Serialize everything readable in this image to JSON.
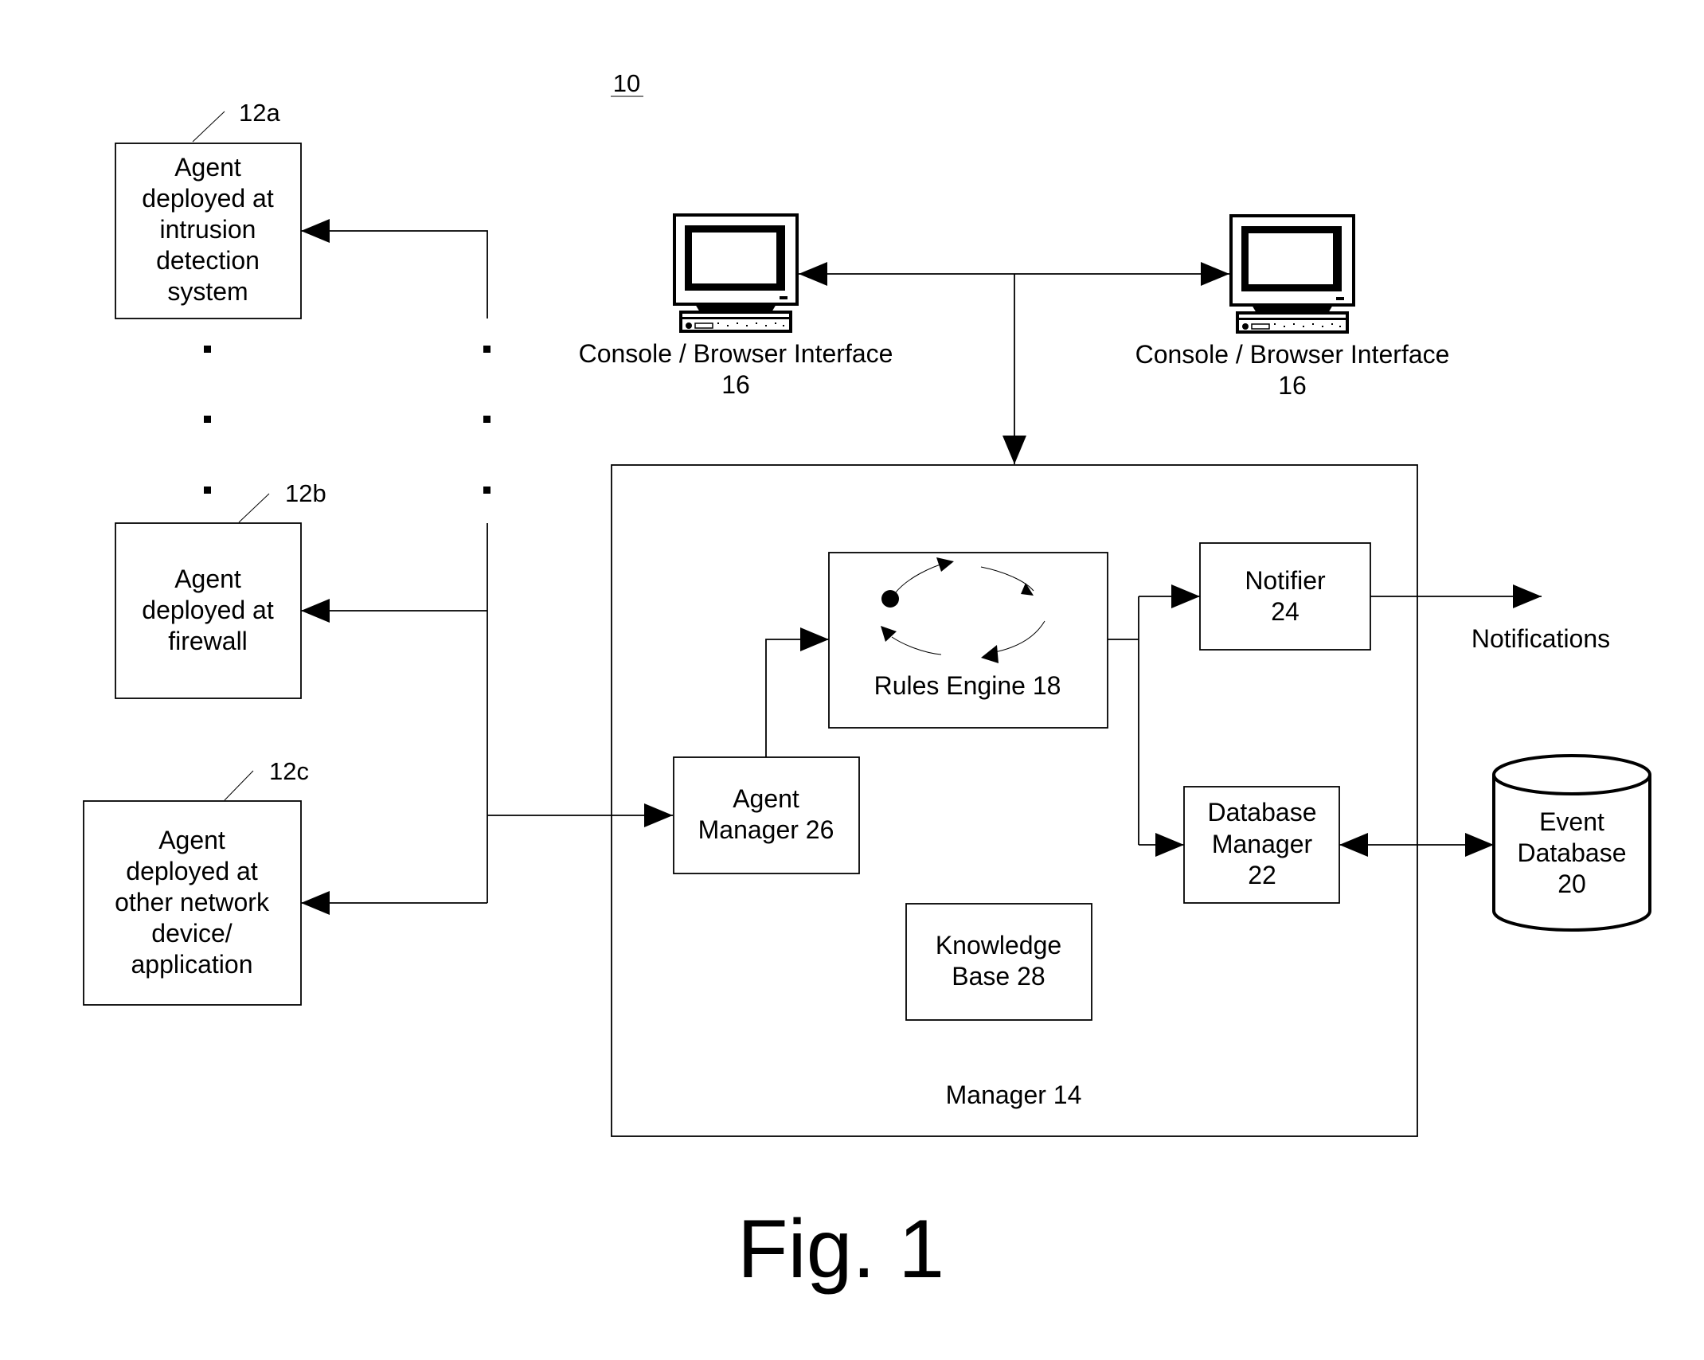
{
  "figure": {
    "ref_number": "10",
    "caption": "Fig. 1"
  },
  "agents": [
    {
      "ref": "12a",
      "lines": [
        "Agent",
        "deployed at",
        "intrusion",
        "detection",
        "system"
      ]
    },
    {
      "ref": "12b",
      "lines": [
        "Agent",
        "deployed at",
        "firewall"
      ]
    },
    {
      "ref": "12c",
      "lines": [
        "Agent",
        "deployed at",
        "other network",
        "device/",
        "application"
      ]
    }
  ],
  "consoles": [
    {
      "label": "Console / Browser Interface",
      "ref": "16",
      "icon": "computer-monitor-icon"
    },
    {
      "label": "Console / Browser Interface",
      "ref": "16",
      "icon": "computer-monitor-icon"
    }
  ],
  "manager": {
    "label": "Manager 14"
  },
  "components": {
    "rules_engine": {
      "label": "Rules Engine 18",
      "icon": "cycle-icon"
    },
    "agent_manager": {
      "lines": [
        "Agent",
        "Manager 26"
      ]
    },
    "notifier": {
      "lines": [
        "Notifier",
        "24"
      ]
    },
    "database_manager": {
      "lines": [
        "Database",
        "Manager",
        "22"
      ]
    },
    "knowledge_base": {
      "lines": [
        "Knowledge",
        "Base 28"
      ]
    }
  },
  "event_database": {
    "lines": [
      "Event",
      "Database",
      "20"
    ],
    "icon": "database-cylinder-icon"
  },
  "notifications": {
    "label": "Notifications"
  },
  "ellipsis_glyph": "▪"
}
